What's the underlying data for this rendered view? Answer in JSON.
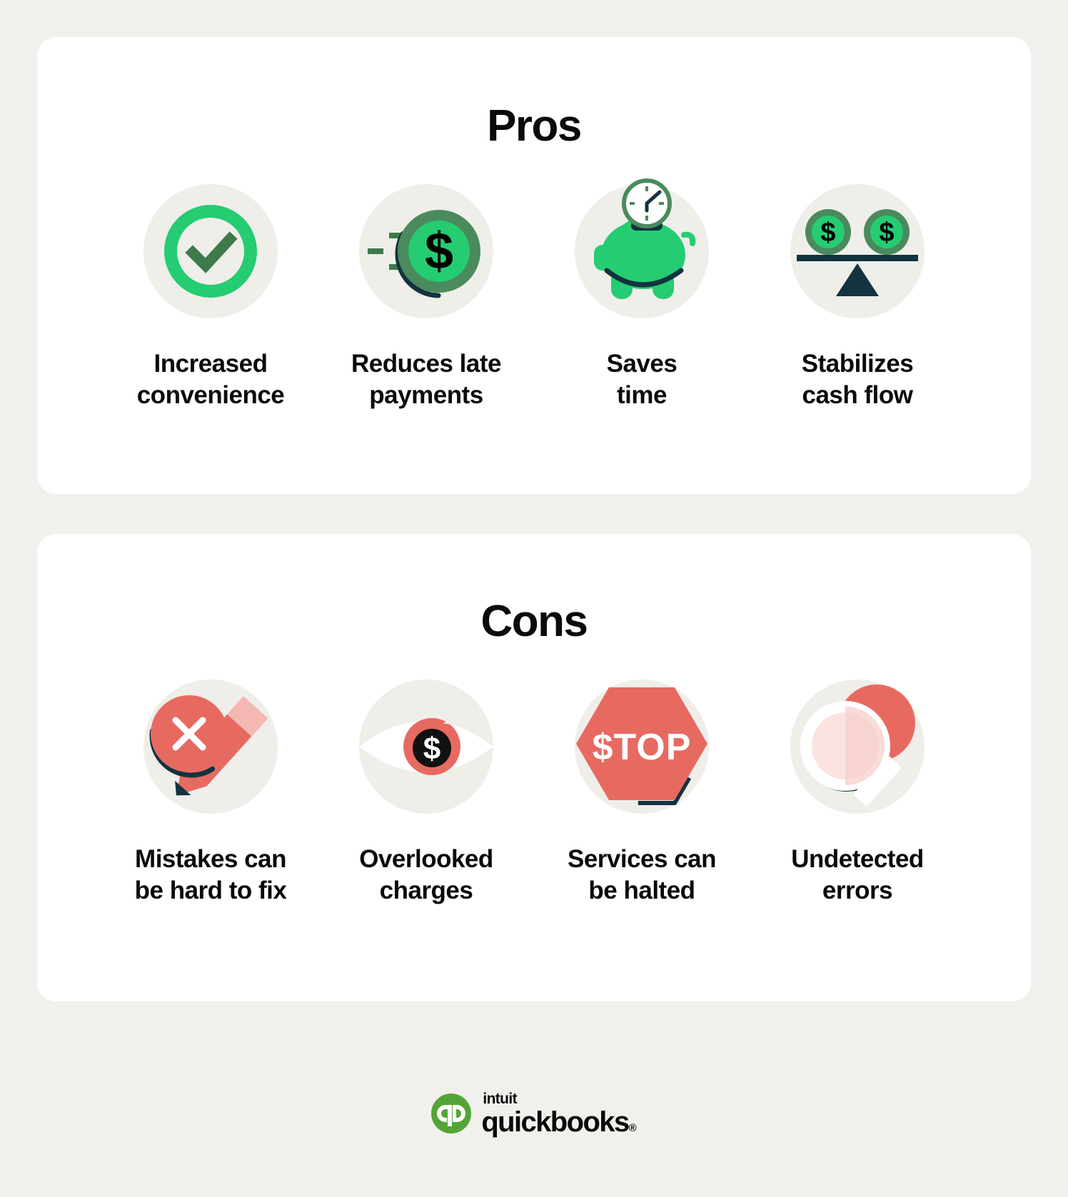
{
  "page": {
    "background_color": "#F1F0EC",
    "card_color": "#FFFFFF",
    "icon_circle_color": "#EFEEE9",
    "green_bright": "#2CC56F",
    "green_dark": "#4A8A5C",
    "navy": "#12333F",
    "coral": "#E76A61",
    "coral_light": "#F4B8B2",
    "text_color": "#0A0A0A"
  },
  "pros": {
    "title": "Pros",
    "items": [
      {
        "icon": "check-circle-icon",
        "label": "Increased\nconvenience"
      },
      {
        "icon": "fast-dollar-coin-icon",
        "label": "Reduces late\npayments"
      },
      {
        "icon": "piggy-bank-clock-icon",
        "label": "Saves\ntime"
      },
      {
        "icon": "balance-scale-coins-icon",
        "label": "Stabilizes\ncash flow"
      }
    ]
  },
  "cons": {
    "title": "Cons",
    "items": [
      {
        "icon": "pencil-error-icon",
        "label": "Mistakes can\nbe hard to fix"
      },
      {
        "icon": "eye-dollar-icon",
        "label": "Overlooked\ncharges"
      },
      {
        "icon": "stop-sign-icon",
        "label": "Services can\nbe halted"
      },
      {
        "icon": "magnifying-glass-icon",
        "label": "Undetected\nerrors"
      }
    ]
  },
  "icons": {
    "stop_sign_text": "$TOP",
    "dollar_symbol": "$"
  },
  "footer": {
    "logo_intuit": "intuit",
    "logo_quickbooks": "quickbooks",
    "logo_registered": "®"
  }
}
